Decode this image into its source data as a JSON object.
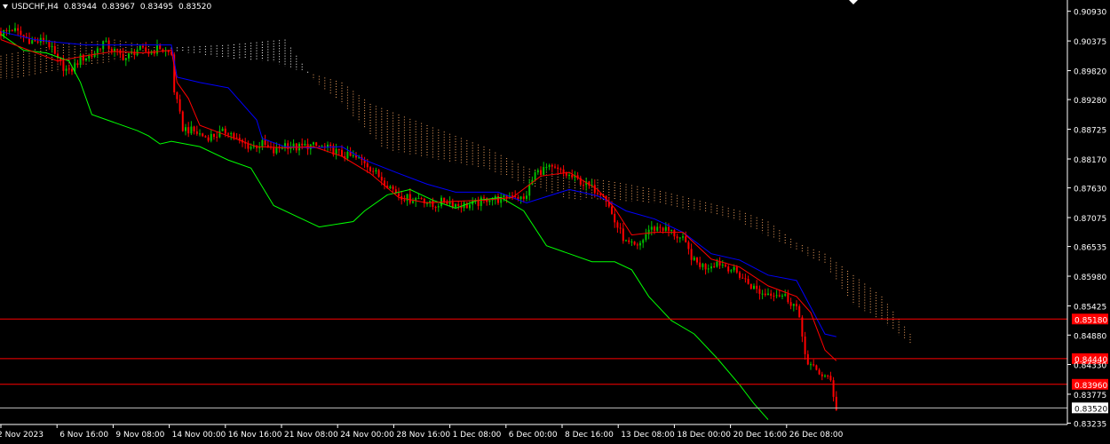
{
  "header": {
    "symbol": "USDCHF,H4",
    "open": "0.83944",
    "high": "0.83967",
    "low": "0.83495",
    "close": "0.83520"
  },
  "colors": {
    "background": "#000000",
    "axis": "#ffffff",
    "bull": "#00c000",
    "bear": "#ff0000",
    "tenkan": "#ff0000",
    "kijun": "#0000ff",
    "chikou": "#00ff00",
    "cloud_a": "#f4a460",
    "cloud_b": "#ffffff",
    "level_line": "#ff0000",
    "price_line": "#c0c0c0"
  },
  "chart_data": {
    "type": "candlestick",
    "indicator": "Ichimoku Kinko Hyo",
    "ylim": [
      0.8321,
      0.9114
    ],
    "y_ticks": [
      "0.90930",
      "0.90375",
      "0.89820",
      "0.89280",
      "0.88725",
      "0.88170",
      "0.87630",
      "0.87075",
      "0.86535",
      "0.85980",
      "0.85425",
      "0.84880",
      "0.84330",
      "0.83775",
      "0.83235"
    ],
    "x_ticks": [
      "2 Nov 2023",
      "6 Nov 16:00",
      "9 Nov 08:00",
      "14 Nov 00:00",
      "16 Nov 16:00",
      "21 Nov 08:00",
      "24 Nov 00:00",
      "28 Nov 16:00",
      "1 Dec 08:00",
      "6 Dec 00:00",
      "8 Dec 16:00",
      "13 Dec 08:00",
      "18 Dec 00:00",
      "20 Dec 16:00",
      "26 Dec 08:00"
    ],
    "horizontal_levels": [
      {
        "label": "0.85180",
        "value": 0.8518,
        "style": "red"
      },
      {
        "label": "0.84440",
        "value": 0.8444,
        "style": "red"
      },
      {
        "label": "0.83960",
        "value": 0.8396,
        "style": "red"
      },
      {
        "label": "0.83520",
        "value": 0.8352,
        "style": "price"
      }
    ],
    "close_path": [
      [
        0,
        0.9052
      ],
      [
        4,
        0.906
      ],
      [
        8,
        0.9045
      ],
      [
        12,
        0.9035
      ],
      [
        16,
        0.904
      ],
      [
        20,
        0.9
      ],
      [
        24,
        0.8978
      ],
      [
        28,
        0.9005
      ],
      [
        32,
        0.901
      ],
      [
        36,
        0.9035
      ],
      [
        40,
        0.9018
      ],
      [
        44,
        0.9005
      ],
      [
        48,
        0.9022
      ],
      [
        52,
        0.9016
      ],
      [
        56,
        0.9025
      ],
      [
        60,
        0.9012
      ],
      [
        61,
        0.8945
      ],
      [
        64,
        0.8875
      ],
      [
        68,
        0.8868
      ],
      [
        72,
        0.8858
      ],
      [
        76,
        0.8862
      ],
      [
        80,
        0.887
      ],
      [
        84,
        0.8848
      ],
      [
        88,
        0.884
      ],
      [
        92,
        0.8845
      ],
      [
        96,
        0.883
      ],
      [
        100,
        0.8845
      ],
      [
        104,
        0.8838
      ],
      [
        108,
        0.8842
      ],
      [
        112,
        0.884
      ],
      [
        116,
        0.8835
      ],
      [
        120,
        0.8825
      ],
      [
        124,
        0.882
      ],
      [
        128,
        0.8812
      ],
      [
        132,
        0.879
      ],
      [
        136,
        0.877
      ],
      [
        140,
        0.875
      ],
      [
        144,
        0.8742
      ],
      [
        148,
        0.8745
      ],
      [
        152,
        0.8728
      ],
      [
        156,
        0.874
      ],
      [
        160,
        0.8732
      ],
      [
        164,
        0.873
      ],
      [
        168,
        0.8735
      ],
      [
        172,
        0.8745
      ],
      [
        176,
        0.874
      ],
      [
        180,
        0.8752
      ],
      [
        184,
        0.874
      ],
      [
        188,
        0.879
      ],
      [
        192,
        0.88
      ],
      [
        196,
        0.8795
      ],
      [
        200,
        0.8785
      ],
      [
        204,
        0.8775
      ],
      [
        208,
        0.8762
      ],
      [
        212,
        0.8755
      ],
      [
        216,
        0.87
      ],
      [
        220,
        0.866
      ],
      [
        224,
        0.865
      ],
      [
        228,
        0.8685
      ],
      [
        232,
        0.869
      ],
      [
        236,
        0.868
      ],
      [
        240,
        0.8665
      ],
      [
        244,
        0.8625
      ],
      [
        248,
        0.8615
      ],
      [
        252,
        0.8625
      ],
      [
        256,
        0.8615
      ],
      [
        260,
        0.86
      ],
      [
        264,
        0.858
      ],
      [
        268,
        0.8565
      ],
      [
        272,
        0.8568
      ],
      [
        276,
        0.856
      ],
      [
        280,
        0.854
      ],
      [
        284,
        0.8432
      ],
      [
        288,
        0.8418
      ],
      [
        292,
        0.8402
      ],
      [
        294,
        0.8352
      ]
    ],
    "kijun": [
      [
        0,
        0.9055
      ],
      [
        12,
        0.904
      ],
      [
        20,
        0.9035
      ],
      [
        30,
        0.903
      ],
      [
        60,
        0.903
      ],
      [
        62,
        0.897
      ],
      [
        70,
        0.896
      ],
      [
        80,
        0.895
      ],
      [
        90,
        0.889
      ],
      [
        92,
        0.8855
      ],
      [
        100,
        0.884
      ],
      [
        110,
        0.8838
      ],
      [
        120,
        0.884
      ],
      [
        128,
        0.8815
      ],
      [
        140,
        0.879
      ],
      [
        150,
        0.877
      ],
      [
        160,
        0.8755
      ],
      [
        175,
        0.8755
      ],
      [
        185,
        0.8735
      ],
      [
        200,
        0.876
      ],
      [
        210,
        0.8748
      ],
      [
        215,
        0.8735
      ],
      [
        220,
        0.872
      ],
      [
        230,
        0.8705
      ],
      [
        240,
        0.868
      ],
      [
        250,
        0.864
      ],
      [
        260,
        0.8628
      ],
      [
        270,
        0.86
      ],
      [
        280,
        0.859
      ],
      [
        285,
        0.854
      ],
      [
        290,
        0.849
      ],
      [
        294,
        0.8485
      ]
    ],
    "tenkan": [
      [
        0,
        0.904
      ],
      [
        10,
        0.902
      ],
      [
        20,
        0.9
      ],
      [
        30,
        0.901
      ],
      [
        40,
        0.9018
      ],
      [
        50,
        0.9015
      ],
      [
        60,
        0.902
      ],
      [
        62,
        0.896
      ],
      [
        66,
        0.893
      ],
      [
        70,
        0.888
      ],
      [
        80,
        0.886
      ],
      [
        90,
        0.884
      ],
      [
        100,
        0.8838
      ],
      [
        110,
        0.884
      ],
      [
        120,
        0.8822
      ],
      [
        130,
        0.879
      ],
      [
        140,
        0.8745
      ],
      [
        150,
        0.8735
      ],
      [
        160,
        0.8738
      ],
      [
        170,
        0.874
      ],
      [
        180,
        0.8745
      ],
      [
        190,
        0.8785
      ],
      [
        200,
        0.8792
      ],
      [
        210,
        0.876
      ],
      [
        216,
        0.8725
      ],
      [
        222,
        0.8675
      ],
      [
        230,
        0.868
      ],
      [
        240,
        0.868
      ],
      [
        250,
        0.863
      ],
      [
        260,
        0.8615
      ],
      [
        270,
        0.858
      ],
      [
        280,
        0.856
      ],
      [
        285,
        0.853
      ],
      [
        290,
        0.846
      ],
      [
        294,
        0.844
      ]
    ],
    "chikou": [
      [
        0,
        0.905
      ],
      [
        8,
        0.902
      ],
      [
        16,
        0.9015
      ],
      [
        24,
        0.9
      ],
      [
        28,
        0.896
      ],
      [
        32,
        0.89
      ],
      [
        40,
        0.8885
      ],
      [
        48,
        0.887
      ],
      [
        52,
        0.886
      ],
      [
        56,
        0.8845
      ],
      [
        60,
        0.885
      ],
      [
        70,
        0.884
      ],
      [
        80,
        0.8815
      ],
      [
        88,
        0.88
      ],
      [
        96,
        0.873
      ],
      [
        104,
        0.871
      ],
      [
        112,
        0.869
      ],
      [
        124,
        0.87
      ],
      [
        128,
        0.872
      ],
      [
        136,
        0.875
      ],
      [
        144,
        0.876
      ],
      [
        152,
        0.874
      ],
      [
        160,
        0.8725
      ],
      [
        168,
        0.874
      ],
      [
        176,
        0.8745
      ],
      [
        184,
        0.872
      ],
      [
        192,
        0.8655
      ],
      [
        200,
        0.864
      ],
      [
        208,
        0.8625
      ],
      [
        216,
        0.8625
      ],
      [
        222,
        0.861
      ],
      [
        228,
        0.856
      ],
      [
        236,
        0.8515
      ],
      [
        244,
        0.849
      ],
      [
        252,
        0.8445
      ],
      [
        260,
        0.8395
      ],
      [
        265,
        0.836
      ],
      [
        270,
        0.833
      ]
    ],
    "span_a": [
      [
        0,
        0.901
      ],
      [
        20,
        0.903
      ],
      [
        40,
        0.904
      ],
      [
        60,
        0.902
      ],
      [
        80,
        0.9005
      ],
      [
        95,
        0.9
      ],
      [
        100,
        0.899
      ],
      [
        110,
        0.8975
      ],
      [
        120,
        0.896
      ],
      [
        130,
        0.892
      ],
      [
        150,
        0.888
      ],
      [
        170,
        0.884
      ],
      [
        185,
        0.88
      ],
      [
        200,
        0.8785
      ],
      [
        215,
        0.8775
      ],
      [
        230,
        0.876
      ],
      [
        245,
        0.874
      ],
      [
        260,
        0.872
      ],
      [
        270,
        0.87
      ],
      [
        280,
        0.866
      ],
      [
        290,
        0.864
      ],
      [
        300,
        0.86
      ],
      [
        310,
        0.856
      ],
      [
        320,
        0.849
      ]
    ],
    "span_b": [
      [
        0,
        0.8965
      ],
      [
        20,
        0.898
      ],
      [
        40,
        0.9
      ],
      [
        60,
        0.9025
      ],
      [
        80,
        0.903
      ],
      [
        100,
        0.904
      ],
      [
        110,
        0.8965
      ],
      [
        120,
        0.892
      ],
      [
        135,
        0.8835
      ],
      [
        150,
        0.882
      ],
      [
        170,
        0.88
      ],
      [
        185,
        0.877
      ],
      [
        200,
        0.8742
      ],
      [
        215,
        0.874
      ],
      [
        230,
        0.8735
      ],
      [
        245,
        0.872
      ],
      [
        260,
        0.87
      ],
      [
        275,
        0.866
      ],
      [
        290,
        0.862
      ],
      [
        300,
        0.8545
      ],
      [
        310,
        0.8515
      ],
      [
        320,
        0.847
      ]
    ]
  }
}
